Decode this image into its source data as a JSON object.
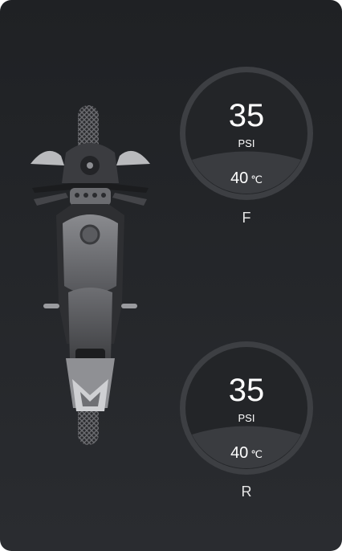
{
  "front": {
    "label": "F",
    "pressure": "35",
    "unit": "PSI",
    "temperature": "40",
    "temperature_unit": "℃"
  },
  "rear": {
    "label": "R",
    "pressure": "35",
    "unit": "PSI",
    "temperature": "40",
    "temperature_unit": "℃"
  },
  "colors": {
    "background_top": "#1f2124",
    "background_bottom": "#2a2c30",
    "gauge_ring": "#3d3f43",
    "gauge_fill": "#26282b",
    "text": "#ffffff"
  },
  "icons": [
    "motorcycle-top-view-icon"
  ]
}
